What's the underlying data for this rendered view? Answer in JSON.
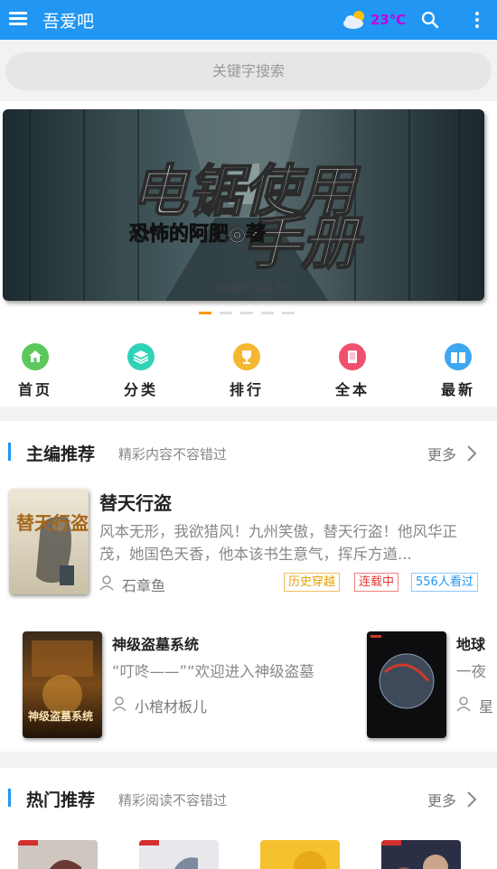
{
  "app": {
    "title": "吾爱吧",
    "temperature": "23℃",
    "icons": [
      "menu-icon",
      "weather-icon",
      "search-icon",
      "more-vert-icon"
    ]
  },
  "search": {
    "placeholder": "关键字搜索"
  },
  "banner": {
    "art_text_main": "电锯使用",
    "art_text_big": "手册",
    "art_text_author": "恐怖的阿肥◎著",
    "caption": "电锯使用手册",
    "dots_count": 5,
    "active_dot": 1
  },
  "nav": [
    {
      "label": "首页",
      "icon": "home-icon",
      "color": "#5cc85c"
    },
    {
      "label": "分类",
      "icon": "layers-icon",
      "color": "#2ed3b7"
    },
    {
      "label": "排行",
      "icon": "trophy-icon",
      "color": "#f5b731"
    },
    {
      "label": "全本",
      "icon": "book-icon",
      "color": "#f0506e"
    },
    {
      "label": "最新",
      "icon": "open-book-icon",
      "color": "#3fa6f0"
    }
  ],
  "editor_pick": {
    "title": "主编推荐",
    "subtitle": "精彩内容不容错过",
    "more": "更多",
    "featured": {
      "title": "替天行盗",
      "description": "风本无形，我欲猎风！九州笑傲，替天行盗！他风华正茂，她国色天香，他本该书生意气，挥斥方遒...",
      "author": "石章鱼",
      "tags": [
        "历史穿越",
        "连载中",
        "556人看过"
      ],
      "cover_text": "替天行盗"
    },
    "books": [
      {
        "title": "神级盗墓系统",
        "description": "“叮咚——”“欢迎进入神级盗墓",
        "author": "小棺材板儿",
        "cover_text": "神级盗墓系统"
      },
      {
        "title": "地球",
        "description": "一夜",
        "author": "星",
        "cover_text": ""
      }
    ]
  },
  "hot_pick": {
    "title": "热门推荐",
    "subtitle": "精彩阅读不容错过",
    "more": "更多"
  },
  "colors": {
    "accent": "#2196f3",
    "active_dot": "#ff9800",
    "tag_history": "#e6a000",
    "tag_status": "#e53935",
    "tag_views": "#2196f3"
  }
}
